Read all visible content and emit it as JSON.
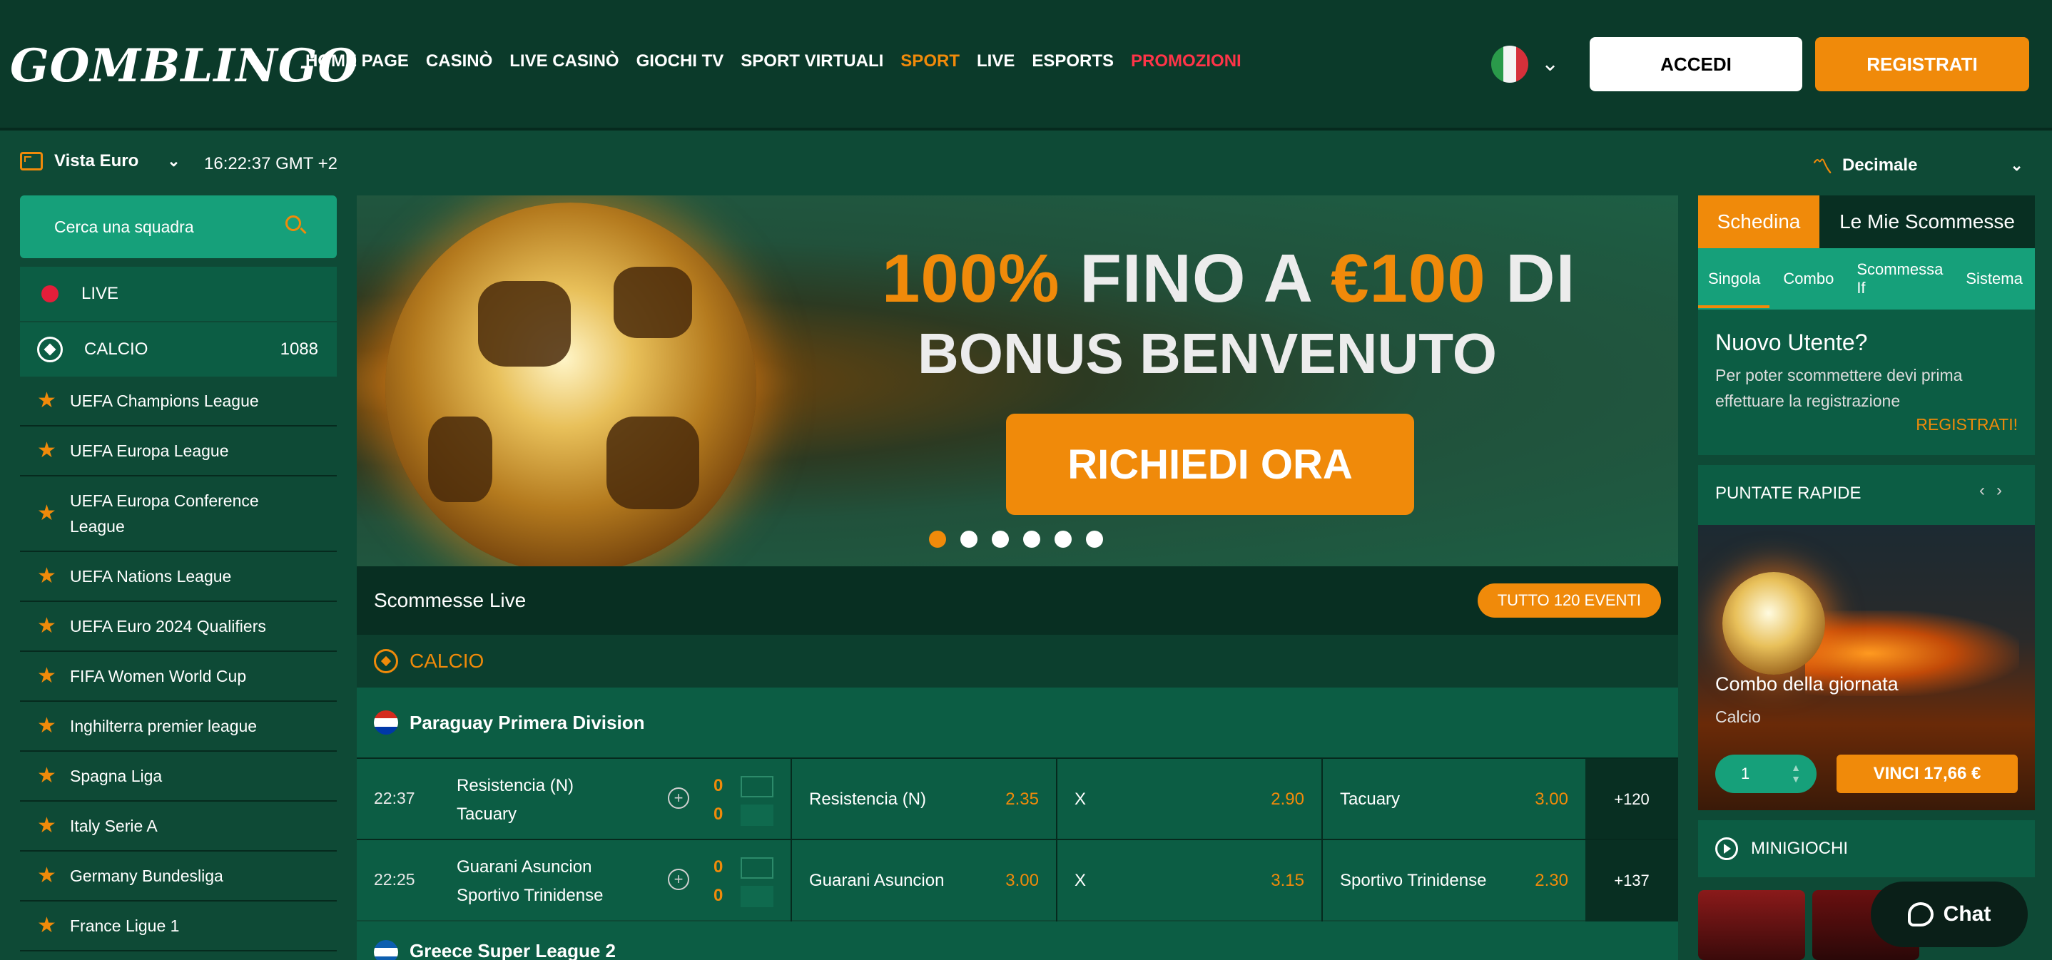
{
  "header": {
    "logo": "GOMBLINGO",
    "nav": [
      {
        "label": "HOME PAGE",
        "state": "normal"
      },
      {
        "label": "CASINÒ",
        "state": "normal"
      },
      {
        "label": "LIVE CASINÒ",
        "state": "normal"
      },
      {
        "label": "GIOCHI TV",
        "state": "normal"
      },
      {
        "label": "SPORT VIRTUALI",
        "state": "normal"
      },
      {
        "label": "SPORT",
        "state": "active"
      },
      {
        "label": "LIVE",
        "state": "normal"
      },
      {
        "label": "ESPORTS",
        "state": "normal"
      },
      {
        "label": "PROMOZIONI",
        "state": "promo"
      }
    ],
    "login_label": "ACCEDI",
    "register_label": "REGISTRATI",
    "language_flag": "italy-flag"
  },
  "subbar": {
    "view_label": "Vista Euro",
    "clock": "16:22:37 GMT +2",
    "odds_format": "Decimale"
  },
  "sidebar": {
    "search_placeholder": "Cerca una squadra",
    "live_label": "LIVE",
    "calcio_label": "CALCIO",
    "calcio_count": "1088",
    "leagues": [
      "UEFA Champions League",
      "UEFA Europa League",
      "UEFA Europa Conference League",
      "UEFA Nations League",
      "UEFA Euro 2024 Qualifiers",
      "FIFA Women World Cup",
      "Inghilterra premier league",
      "Spagna Liga",
      "Italy Serie A",
      "Germany Bundesliga",
      "France Ligue 1"
    ]
  },
  "banner": {
    "line1_a": "100%",
    "line1_b": " FINO A ",
    "line1_c": "€100",
    "line1_d": " DI",
    "line2": "BONUS BENVENUTO",
    "cta": "RICHIEDI ORA",
    "slides_total": 6,
    "slide_active": 1
  },
  "live": {
    "title": "Scommesse Live",
    "all_events": "TUTTO 120 EVENTI",
    "sport": "CALCIO",
    "league1": "Paraguay Primera Division",
    "league2": "Greece Super League 2",
    "matches": [
      {
        "time": "22:37",
        "home": "Resistencia (N)",
        "away": "Tacuary",
        "score_home": "0",
        "score_away": "0",
        "odd1_label": "Resistencia (N)",
        "odd1": "2.35",
        "oddx_label": "X",
        "oddx": "2.90",
        "odd2_label": "Tacuary",
        "odd2": "3.00",
        "more": "+120"
      },
      {
        "time": "22:25",
        "home": "Guarani Asuncion",
        "away": "Sportivo Trinidense",
        "score_home": "0",
        "score_away": "0",
        "odd1_label": "Guarani Asuncion",
        "odd1": "3.00",
        "oddx_label": "X",
        "oddx": "3.15",
        "odd2_label": "Sportivo Trinidense",
        "odd2": "2.30",
        "more": "+137"
      }
    ]
  },
  "betslip": {
    "tab_active": "Schedina",
    "tab_other": "Le Mie Scommesse",
    "subtabs": [
      "Singola",
      "Combo",
      "Scommessa If",
      "Sistema"
    ],
    "new_user_title": "Nuovo Utente?",
    "new_user_text": "Per poter scommettere devi prima effettuare la registrazione",
    "register_link": "REGISTRATI!"
  },
  "quick_bets": {
    "title": "PUNTATE RAPIDE",
    "card_title": "Combo della giornata",
    "card_sport": "Calcio",
    "stake": "1",
    "win_label": "VINCI 17,66 €"
  },
  "minigames": {
    "title": "MINIGIOCHI"
  },
  "chat": {
    "label": "Chat"
  },
  "colors": {
    "accent": "#f08a0a",
    "promo": "#ff3448",
    "bg": "#0e4a36",
    "panel": "#0c5d44",
    "header": "#0b3a2a"
  }
}
